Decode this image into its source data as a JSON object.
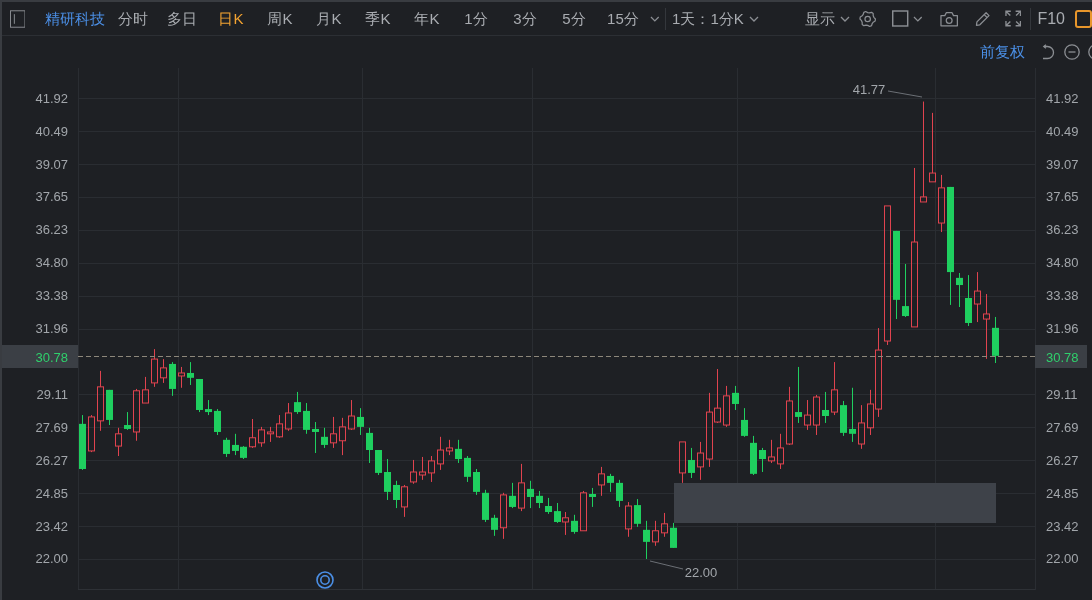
{
  "toolbar": {
    "stock_name": "精研科技",
    "periods": [
      {
        "label": "分时",
        "selected": false
      },
      {
        "label": "多日",
        "selected": false
      },
      {
        "label": "日K",
        "selected": true
      },
      {
        "label": "周K",
        "selected": false
      },
      {
        "label": "月K",
        "selected": false
      },
      {
        "label": "季K",
        "selected": false
      },
      {
        "label": "年K",
        "selected": false
      },
      {
        "label": "1分",
        "selected": false
      },
      {
        "label": "3分",
        "selected": false
      },
      {
        "label": "5分",
        "selected": false
      },
      {
        "label": "15分",
        "selected": false
      }
    ],
    "range_selector": "1天：1分K",
    "display_menu": "显示",
    "f10_button": "F10"
  },
  "sub_toolbar": {
    "price_adjustment": "前复权"
  },
  "chart": {
    "right_axis": {
      "upper_ticks": [
        "41.92",
        "40.49",
        "39.07",
        "37.65",
        "36.23",
        "34.80",
        "33.38",
        "31.96"
      ],
      "lower_ticks": [
        "29.11",
        "27.69",
        "26.27",
        "24.85",
        "23.42",
        "22.00"
      ]
    },
    "current_price": {
      "left_label": "30.78",
      "right_label": "30.78"
    },
    "high_label": "41.77",
    "low_label": "22.00",
    "chart_data": {
      "type": "candlestick",
      "grid": true,
      "ylim": [
        20.66,
        43.22
      ],
      "yticks": [
        {
          "value": 41.92,
          "label": "41.92"
        },
        {
          "value": 40.49,
          "label": "40.49"
        },
        {
          "value": 39.07,
          "label": "39.07"
        },
        {
          "value": 37.65,
          "label": "37.65"
        },
        {
          "value": 36.23,
          "label": "36.23"
        },
        {
          "value": 34.8,
          "label": "34.80"
        },
        {
          "value": 33.38,
          "label": "33.38"
        },
        {
          "value": 31.96,
          "label": "31.96"
        },
        {
          "value": 29.11,
          "label": "29.11"
        },
        {
          "value": 27.69,
          "label": "27.69"
        },
        {
          "value": 26.27,
          "label": "26.27"
        },
        {
          "value": 24.85,
          "label": "24.85"
        },
        {
          "value": 23.42,
          "label": "23.42"
        },
        {
          "value": 22,
          "label": "22.00"
        }
      ],
      "ref_lines": [
        {
          "axis": "y",
          "value": 30.78
        }
      ],
      "categories": [
        null,
        null,
        null,
        null,
        null,
        null,
        null,
        null,
        null,
        null,
        null,
        null,
        null,
        null,
        null,
        null,
        null,
        null,
        null,
        null,
        null,
        null,
        null,
        null,
        null,
        null,
        null,
        null,
        null,
        null,
        null,
        null,
        null,
        null,
        null,
        null,
        null,
        null,
        null,
        null,
        null,
        null,
        null,
        null,
        null,
        null,
        null,
        null,
        null,
        null,
        null,
        null,
        null,
        null,
        null,
        null,
        null,
        null,
        null,
        null,
        null,
        null,
        null,
        null,
        null,
        null,
        null,
        null,
        null,
        null,
        null,
        null,
        null,
        null,
        null,
        null,
        null,
        null,
        null,
        null,
        null,
        null,
        null,
        null,
        null,
        null,
        null,
        null,
        null,
        null,
        null,
        null,
        null,
        null,
        null,
        null,
        null,
        null,
        null,
        null,
        null,
        null,
        null,
        null,
        null,
        null,
        null
      ],
      "ohlc": [
        [
          27.84,
          28.22,
          25.85,
          25.89
        ],
        [
          26.67,
          28.22,
          26.62,
          28.14
        ],
        [
          27.97,
          30.13,
          27.54,
          29.44
        ],
        [
          29.31,
          29.31,
          27.79,
          28.01
        ],
        [
          26.88,
          27.67,
          26.45,
          27.41
        ],
        [
          27.79,
          28.35,
          27.58,
          27.62
        ],
        [
          27.49,
          29.35,
          27.11,
          29.27
        ],
        [
          28.74,
          29.87,
          28.74,
          29.31
        ],
        [
          29.61,
          31.07,
          29.44,
          30.64
        ],
        [
          29.83,
          30.64,
          29.61,
          30.26
        ],
        [
          30.43,
          30.51,
          29.05,
          29.35
        ],
        [
          29.91,
          30.3,
          29.4,
          30.04
        ],
        [
          30.04,
          30.51,
          29.52,
          29.83
        ],
        [
          29.78,
          29.78,
          28.35,
          28.44
        ],
        [
          28.48,
          28.87,
          28.22,
          28.35
        ],
        [
          28.4,
          28.48,
          27.36,
          27.49
        ],
        [
          27.15,
          27.24,
          26.41,
          26.54
        ],
        [
          26.93,
          27.41,
          26.49,
          26.67
        ],
        [
          26.85,
          26.88,
          26.32,
          26.37
        ],
        [
          26.85,
          28.05,
          26.8,
          27.24
        ],
        [
          27.02,
          27.71,
          26.85,
          27.58
        ],
        [
          27.41,
          27.71,
          27.06,
          27.49
        ],
        [
          27.28,
          28.22,
          27.24,
          27.84
        ],
        [
          27.62,
          28.74,
          27.54,
          28.31
        ],
        [
          28.78,
          29.22,
          28.27,
          28.35
        ],
        [
          28.4,
          28.74,
          27.41,
          27.58
        ],
        [
          27.62,
          27.92,
          26.58,
          27.49
        ],
        [
          27.28,
          27.67,
          26.8,
          26.93
        ],
        [
          27.02,
          28.14,
          26.8,
          27.41
        ],
        [
          27.11,
          28.1,
          26.49,
          27.71
        ],
        [
          27.62,
          28.87,
          27.58,
          28.18
        ],
        [
          28.14,
          28.52,
          27.36,
          27.71
        ],
        [
          27.45,
          27.67,
          26.15,
          26.71
        ],
        [
          26.71,
          26.71,
          25.63,
          25.72
        ],
        [
          25.76,
          26.32,
          24.55,
          24.9
        ],
        [
          25.2,
          25.38,
          24.2,
          24.55
        ],
        [
          24.25,
          25.2,
          23.82,
          25.12
        ],
        [
          25.33,
          26.28,
          25.25,
          25.76
        ],
        [
          25.63,
          26.41,
          25.42,
          25.76
        ],
        [
          25.72,
          26.45,
          25.33,
          26.24
        ],
        [
          26.11,
          27.28,
          25.85,
          26.71
        ],
        [
          26.67,
          27.15,
          26.49,
          26.8
        ],
        [
          26.76,
          27.15,
          26.15,
          26.32
        ],
        [
          26.37,
          26.45,
          25.33,
          25.55
        ],
        [
          25.76,
          25.89,
          24.77,
          24.9
        ],
        [
          24.86,
          24.99,
          23.6,
          23.69
        ],
        [
          23.78,
          23.91,
          23.0,
          23.26
        ],
        [
          23.35,
          24.86,
          22.87,
          24.77
        ],
        [
          24.73,
          25.29,
          24.2,
          24.25
        ],
        [
          24.2,
          26.11,
          24.07,
          25.29
        ],
        [
          25.03,
          25.38,
          24.2,
          24.68
        ],
        [
          24.73,
          24.94,
          24.2,
          24.42
        ],
        [
          24.29,
          24.64,
          23.95,
          24.03
        ],
        [
          24.07,
          24.42,
          23.56,
          23.6
        ],
        [
          23.6,
          24.03,
          23.04,
          23.78
        ],
        [
          23.65,
          23.91,
          23.09,
          23.17
        ],
        [
          23.22,
          24.94,
          23.22,
          24.86
        ],
        [
          24.81,
          25.07,
          24.25,
          24.68
        ],
        [
          25.2,
          25.98,
          24.73,
          25.68
        ],
        [
          25.59,
          25.68,
          24.9,
          25.29
        ],
        [
          25.29,
          25.42,
          24.25,
          24.51
        ],
        [
          23.3,
          24.46,
          22.96,
          24.29
        ],
        [
          24.33,
          24.59,
          23.39,
          23.52
        ],
        [
          23.26,
          23.65,
          22.0,
          22.74
        ],
        [
          22.74,
          23.65,
          22.57,
          23.22
        ],
        [
          23.13,
          23.99,
          22.96,
          23.52
        ],
        [
          23.35,
          23.56,
          22.48,
          22.48
        ],
        [
          25.72,
          27.06,
          25.29,
          27.06
        ],
        [
          26.28,
          26.8,
          25.5,
          25.72
        ],
        [
          25.98,
          27.06,
          25.42,
          26.58
        ],
        [
          26.32,
          29.18,
          25.98,
          28.35
        ],
        [
          27.92,
          30.21,
          27.88,
          28.52
        ],
        [
          27.79,
          29.48,
          27.71,
          29.05
        ],
        [
          29.18,
          29.48,
          28.44,
          28.7
        ],
        [
          28.01,
          28.52,
          27.28,
          27.32
        ],
        [
          27.02,
          27.32,
          25.63,
          25.68
        ],
        [
          26.71,
          26.8,
          25.76,
          26.32
        ],
        [
          26.24,
          27.15,
          26.15,
          26.41
        ],
        [
          26.11,
          27.41,
          25.89,
          26.8
        ],
        [
          26.97,
          29.44,
          26.93,
          28.83
        ],
        [
          28.35,
          30.3,
          27.88,
          28.14
        ],
        [
          27.79,
          28.87,
          27.58,
          28.22
        ],
        [
          27.79,
          29.09,
          27.36,
          29.0
        ],
        [
          28.44,
          29.22,
          27.88,
          28.18
        ],
        [
          28.35,
          30.51,
          28.22,
          29.31
        ],
        [
          28.65,
          28.83,
          27.32,
          27.45
        ],
        [
          27.62,
          29.4,
          27.06,
          27.41
        ],
        [
          26.97,
          28.65,
          26.76,
          27.88
        ],
        [
          27.67,
          29.31,
          27.36,
          28.7
        ],
        [
          28.48,
          31.98,
          28.14,
          31.03
        ],
        [
          31.42,
          37.26,
          31.25,
          37.26
        ],
        [
          36.18,
          36.18,
          32.37,
          33.2
        ],
        [
          32.93,
          34.75,
          32.46,
          32.5
        ],
        [
          32.03,
          38.9,
          32.03,
          35.7
        ],
        [
          37.43,
          41.77,
          37.43,
          37.65
        ],
        [
          38.3,
          41.28,
          38.3,
          38.68
        ],
        [
          36.52,
          38.6,
          36.13,
          38.04
        ],
        [
          38.08,
          38.08,
          32.98,
          34.4
        ],
        [
          34.15,
          34.36,
          32.89,
          33.84
        ],
        [
          33.28,
          34.27,
          32.07,
          32.2
        ],
        [
          33.02,
          34.4,
          32.24,
          33.58
        ],
        [
          32.37,
          33.45,
          30.65,
          32.59
        ],
        [
          31.99,
          32.46,
          30.47,
          30.78
        ],
        null,
        null,
        null,
        null
      ]
    }
  }
}
